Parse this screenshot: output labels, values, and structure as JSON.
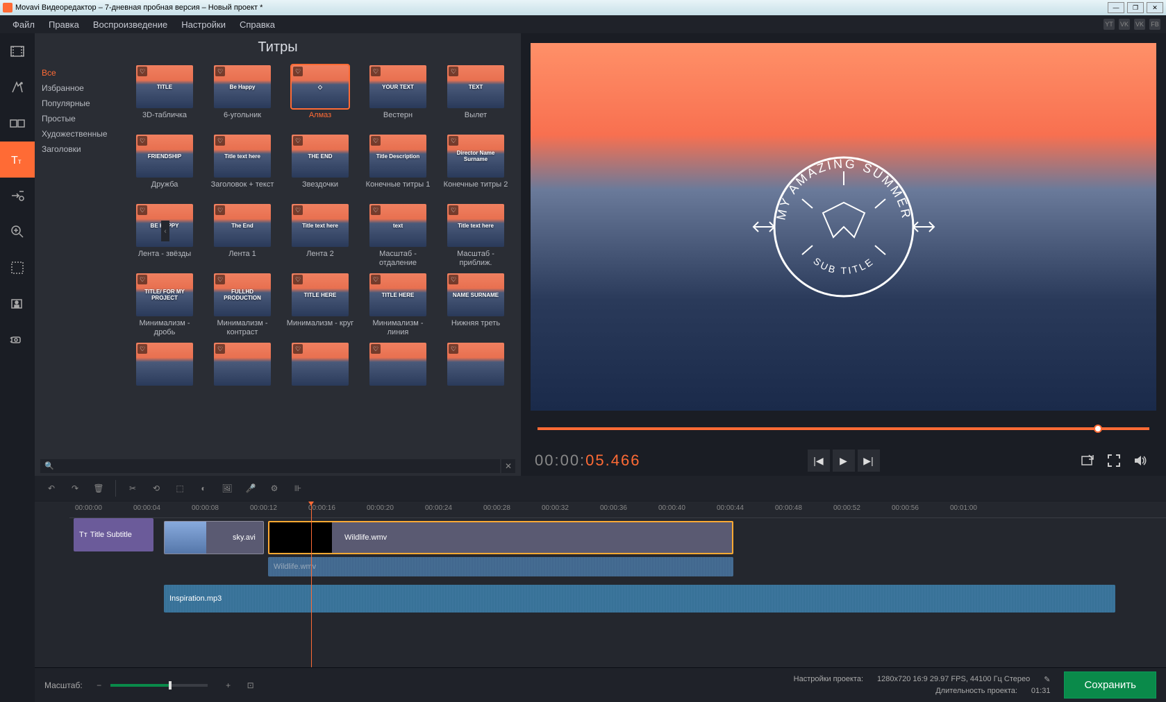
{
  "window": {
    "title": "Movavi Видеоредактор – 7-дневная пробная версия – Новый проект *"
  },
  "menubar": [
    "Файл",
    "Правка",
    "Воспроизведение",
    "Настройки",
    "Справка"
  ],
  "social": [
    "YT",
    "VK",
    "VK",
    "FB"
  ],
  "left_tools": [
    {
      "name": "media-icon"
    },
    {
      "name": "filters-icon"
    },
    {
      "name": "transitions-icon"
    },
    {
      "name": "titles-icon",
      "active": true
    },
    {
      "name": "callouts-icon"
    },
    {
      "name": "zoom-icon"
    },
    {
      "name": "highlight-icon"
    },
    {
      "name": "chroma-icon"
    },
    {
      "name": "record-icon"
    }
  ],
  "titles_panel": {
    "header": "Титры",
    "categories": [
      {
        "label": "Все",
        "active": true
      },
      {
        "label": "Избранное"
      },
      {
        "label": "Популярные"
      },
      {
        "label": "Простые"
      },
      {
        "label": "Художественные"
      },
      {
        "label": "Заголовки"
      }
    ],
    "thumbs": [
      {
        "label": "3D-табличка",
        "overlay": "TITLE"
      },
      {
        "label": "6-угольник",
        "overlay": "Be Happy"
      },
      {
        "label": "Алмаз",
        "overlay": "◇",
        "selected": true
      },
      {
        "label": "Вестерн",
        "overlay": "YOUR TEXT"
      },
      {
        "label": "Вылет",
        "overlay": "TEXT"
      },
      {
        "label": "Дружба",
        "overlay": "FRIENDSHIP"
      },
      {
        "label": "Заголовок + текст",
        "overlay": "Title text here"
      },
      {
        "label": "Звездочки",
        "overlay": "THE END"
      },
      {
        "label": "Конечные титры 1",
        "overlay": "Title Description"
      },
      {
        "label": "Конечные титры 2",
        "overlay": "Director Name Surname"
      },
      {
        "label": "Лента - звёзды",
        "overlay": "BE HAPPY"
      },
      {
        "label": "Лента 1",
        "overlay": "The End"
      },
      {
        "label": "Лента 2",
        "overlay": "Title text here"
      },
      {
        "label": "Масштаб - отдаление",
        "overlay": "text"
      },
      {
        "label": "Масштаб - приближ.",
        "overlay": "Title text here"
      },
      {
        "label": "Минимализм - дробь",
        "overlay": "TITLE/ FOR MY PROJECT"
      },
      {
        "label": "Минимализм - контраст",
        "overlay": "FULLHD PRODUCTION"
      },
      {
        "label": "Минимализм - круг",
        "overlay": "TITLE HERE"
      },
      {
        "label": "Минимализм - линия",
        "overlay": "TITLE HERE"
      },
      {
        "label": "Нижняя треть",
        "overlay": "NAME SURNAME"
      },
      {
        "label": "",
        "overlay": ""
      },
      {
        "label": "",
        "overlay": ""
      },
      {
        "label": "",
        "overlay": ""
      },
      {
        "label": "",
        "overlay": ""
      },
      {
        "label": "",
        "overlay": ""
      }
    ],
    "search_placeholder": "🔍"
  },
  "preview": {
    "badge_top": "MY AMAZING SUMMER",
    "badge_bottom": "SUB TITLE",
    "timecode_prefix": "00:00:",
    "timecode_active": "05.466"
  },
  "ruler_ticks": [
    "00:00:00",
    "00:00:04",
    "00:00:08",
    "00:00:12",
    "00:00:16",
    "00:00:20",
    "00:00:24",
    "00:00:28",
    "00:00:32",
    "00:00:36",
    "00:00:40",
    "00:00:44",
    "00:00:48",
    "00:00:52",
    "00:00:56",
    "00:01:00"
  ],
  "timeline": {
    "title_clip": "Title Subtitle",
    "video1": "sky.avi",
    "video2": "Wildlife.wmv",
    "audio2": "Wildlife.wmv",
    "music": "Inspiration.mp3"
  },
  "statusbar": {
    "zoom_label": "Масштаб:",
    "proj_label": "Настройки проекта:",
    "proj_value": "1280x720 16:9 29.97 FPS, 44100 Гц Стерео",
    "dur_label": "Длительность проекта:",
    "dur_value": "01:31",
    "save": "Сохранить"
  },
  "symbols": {
    "heart": "♡",
    "t_icon": "Tт"
  }
}
